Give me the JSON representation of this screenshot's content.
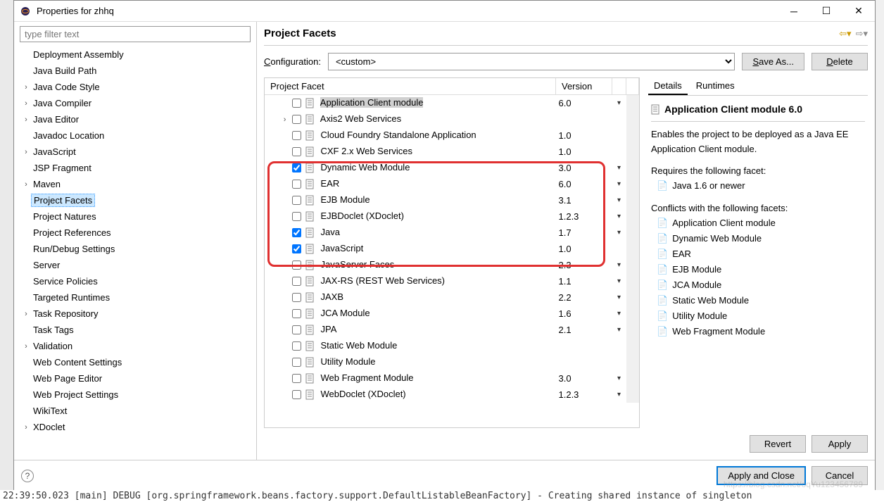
{
  "window": {
    "title": "Properties for zhhq"
  },
  "filter_placeholder": "type filter text",
  "tree": {
    "items": [
      {
        "label": "Deployment Assembly",
        "arrow": ""
      },
      {
        "label": "Java Build Path",
        "arrow": ""
      },
      {
        "label": "Java Code Style",
        "arrow": "›"
      },
      {
        "label": "Java Compiler",
        "arrow": "›"
      },
      {
        "label": "Java Editor",
        "arrow": "›"
      },
      {
        "label": "Javadoc Location",
        "arrow": ""
      },
      {
        "label": "JavaScript",
        "arrow": "›"
      },
      {
        "label": "JSP Fragment",
        "arrow": ""
      },
      {
        "label": "Maven",
        "arrow": "›"
      },
      {
        "label": "Project Facets",
        "arrow": "",
        "selected": true
      },
      {
        "label": "Project Natures",
        "arrow": ""
      },
      {
        "label": "Project References",
        "arrow": ""
      },
      {
        "label": "Run/Debug Settings",
        "arrow": ""
      },
      {
        "label": "Server",
        "arrow": ""
      },
      {
        "label": "Service Policies",
        "arrow": ""
      },
      {
        "label": "Targeted Runtimes",
        "arrow": ""
      },
      {
        "label": "Task Repository",
        "arrow": "›"
      },
      {
        "label": "Task Tags",
        "arrow": ""
      },
      {
        "label": "Validation",
        "arrow": "›"
      },
      {
        "label": "Web Content Settings",
        "arrow": ""
      },
      {
        "label": "Web Page Editor",
        "arrow": ""
      },
      {
        "label": "Web Project Settings",
        "arrow": ""
      },
      {
        "label": "WikiText",
        "arrow": ""
      },
      {
        "label": "XDoclet",
        "arrow": "›"
      }
    ]
  },
  "section_title": "Project Facets",
  "config": {
    "label": "Configuration:",
    "value": "<custom>",
    "save_as": "Save As...",
    "delete": "Delete"
  },
  "table": {
    "col_facet": "Project Facet",
    "col_version": "Version",
    "rows": [
      {
        "indent": 1,
        "arrow": "",
        "checked": false,
        "name": "Application Client module",
        "version": "6.0",
        "dd": "▾",
        "hl": true
      },
      {
        "indent": 1,
        "arrow": "›",
        "checked": false,
        "name": "Axis2 Web Services",
        "version": "",
        "dd": ""
      },
      {
        "indent": 1,
        "arrow": "",
        "checked": false,
        "name": "Cloud Foundry Standalone Application",
        "version": "1.0",
        "dd": ""
      },
      {
        "indent": 1,
        "arrow": "",
        "checked": false,
        "name": "CXF 2.x Web Services",
        "version": "1.0",
        "dd": ""
      },
      {
        "indent": 1,
        "arrow": "",
        "checked": true,
        "name": "Dynamic Web Module",
        "version": "3.0",
        "dd": "▾"
      },
      {
        "indent": 1,
        "arrow": "",
        "checked": false,
        "name": "EAR",
        "version": "6.0",
        "dd": "▾"
      },
      {
        "indent": 1,
        "arrow": "",
        "checked": false,
        "name": "EJB Module",
        "version": "3.1",
        "dd": "▾"
      },
      {
        "indent": 1,
        "arrow": "",
        "checked": false,
        "name": "EJBDoclet (XDoclet)",
        "version": "1.2.3",
        "dd": "▾"
      },
      {
        "indent": 1,
        "arrow": "",
        "checked": true,
        "name": "Java",
        "version": "1.7",
        "dd": "▾"
      },
      {
        "indent": 1,
        "arrow": "",
        "checked": true,
        "name": "JavaScript",
        "version": "1.0",
        "dd": ""
      },
      {
        "indent": 1,
        "arrow": "",
        "checked": false,
        "name": "JavaServer Faces",
        "version": "2.3",
        "dd": "▾"
      },
      {
        "indent": 1,
        "arrow": "",
        "checked": false,
        "name": "JAX-RS (REST Web Services)",
        "version": "1.1",
        "dd": "▾"
      },
      {
        "indent": 1,
        "arrow": "",
        "checked": false,
        "name": "JAXB",
        "version": "2.2",
        "dd": "▾"
      },
      {
        "indent": 1,
        "arrow": "",
        "checked": false,
        "name": "JCA Module",
        "version": "1.6",
        "dd": "▾"
      },
      {
        "indent": 1,
        "arrow": "",
        "checked": false,
        "name": "JPA",
        "version": "2.1",
        "dd": "▾"
      },
      {
        "indent": 1,
        "arrow": "",
        "checked": false,
        "name": "Static Web Module",
        "version": "",
        "dd": ""
      },
      {
        "indent": 1,
        "arrow": "",
        "checked": false,
        "name": "Utility Module",
        "version": "",
        "dd": ""
      },
      {
        "indent": 1,
        "arrow": "",
        "checked": false,
        "name": "Web Fragment Module",
        "version": "3.0",
        "dd": "▾"
      },
      {
        "indent": 1,
        "arrow": "",
        "checked": false,
        "name": "WebDoclet (XDoclet)",
        "version": "1.2.3",
        "dd": "▾"
      }
    ]
  },
  "tabs": {
    "details": "Details",
    "runtimes": "Runtimes"
  },
  "details": {
    "title": "Application Client module 6.0",
    "desc": "Enables the project to be deployed as a Java EE Application Client module.",
    "req_label": "Requires the following facet:",
    "req_items": [
      "Java 1.6 or newer"
    ],
    "conf_label": "Conflicts with the following facets:",
    "conf_items": [
      "Application Client module",
      "Dynamic Web Module",
      "EAR",
      "EJB Module",
      "JCA Module",
      "Static Web Module",
      "Utility Module",
      "Web Fragment Module"
    ]
  },
  "buttons": {
    "revert": "Revert",
    "apply": "Apply",
    "apply_close": "Apply and Close",
    "cancel": "Cancel"
  },
  "console": "22:39:50.023 [main] DEBUG [org.springframework.beans.factory.support.DefaultListableBeanFactory] - Creating shared instance of singleton",
  "watermark": "https://blog.csdn.net/oqYu123456789"
}
